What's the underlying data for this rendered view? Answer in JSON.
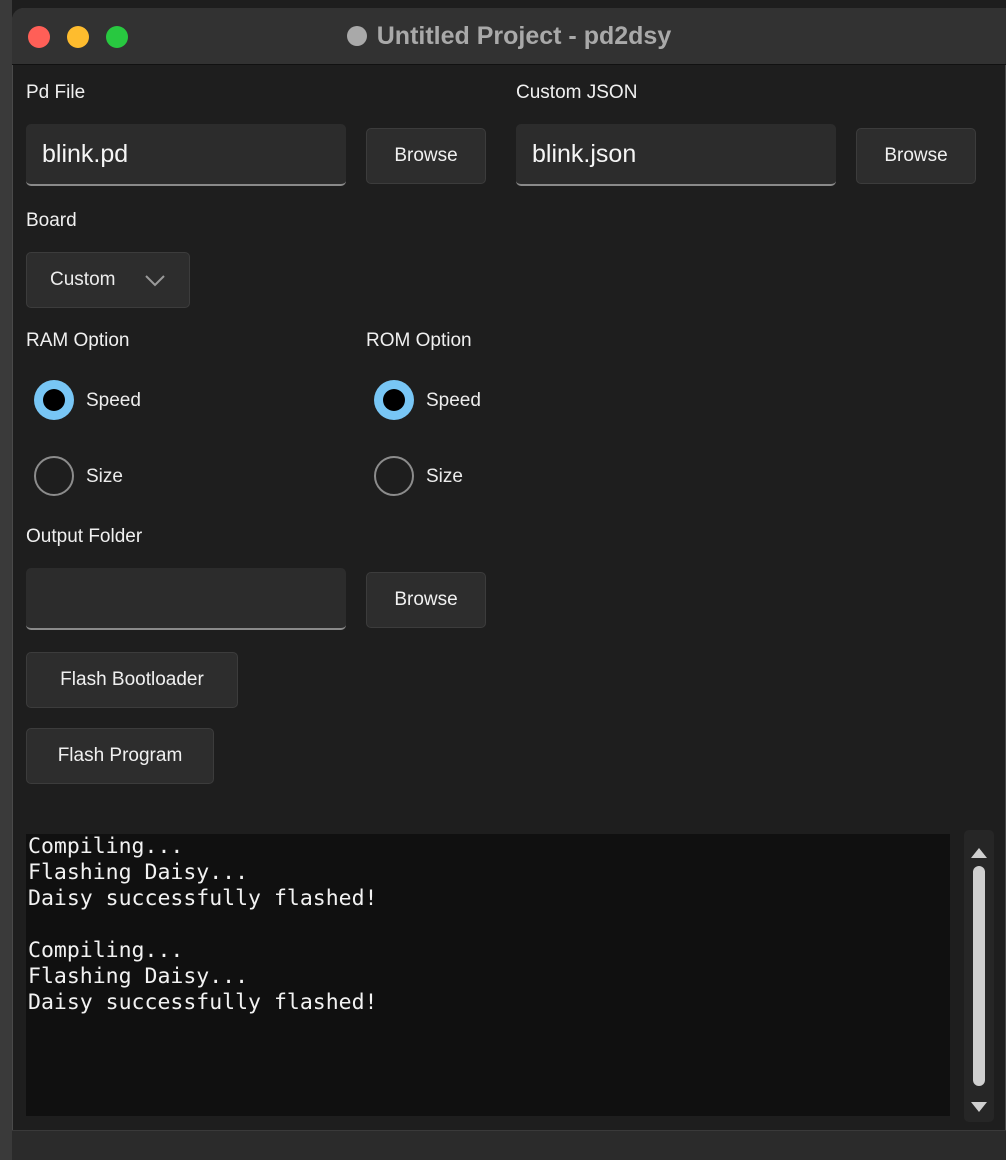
{
  "window": {
    "title": "Untitled Project - pd2dsy"
  },
  "pd_file": {
    "label": "Pd File",
    "value": "blink.pd",
    "browse": "Browse"
  },
  "custom_json": {
    "label": "Custom JSON",
    "value": "blink.json",
    "browse": "Browse"
  },
  "board": {
    "label": "Board",
    "selected": "Custom"
  },
  "ram": {
    "label": "RAM Option",
    "options": [
      {
        "label": "Speed",
        "selected": true
      },
      {
        "label": "Size",
        "selected": false
      }
    ]
  },
  "rom": {
    "label": "ROM Option",
    "options": [
      {
        "label": "Speed",
        "selected": true
      },
      {
        "label": "Size",
        "selected": false
      }
    ]
  },
  "output": {
    "label": "Output Folder",
    "value": "",
    "browse": "Browse"
  },
  "actions": {
    "flash_bootloader": "Flash Bootloader",
    "flash_program": "Flash Program"
  },
  "console": {
    "lines": [
      "Compiling...",
      "Flashing Daisy...",
      "Daisy successfully flashed!",
      "",
      "Compiling...",
      "Flashing Daisy...",
      "Daisy successfully flashed!"
    ]
  },
  "colors": {
    "accent_radio": "#78c6f5",
    "background": "#1e1e1e",
    "console_bg": "#101010"
  }
}
